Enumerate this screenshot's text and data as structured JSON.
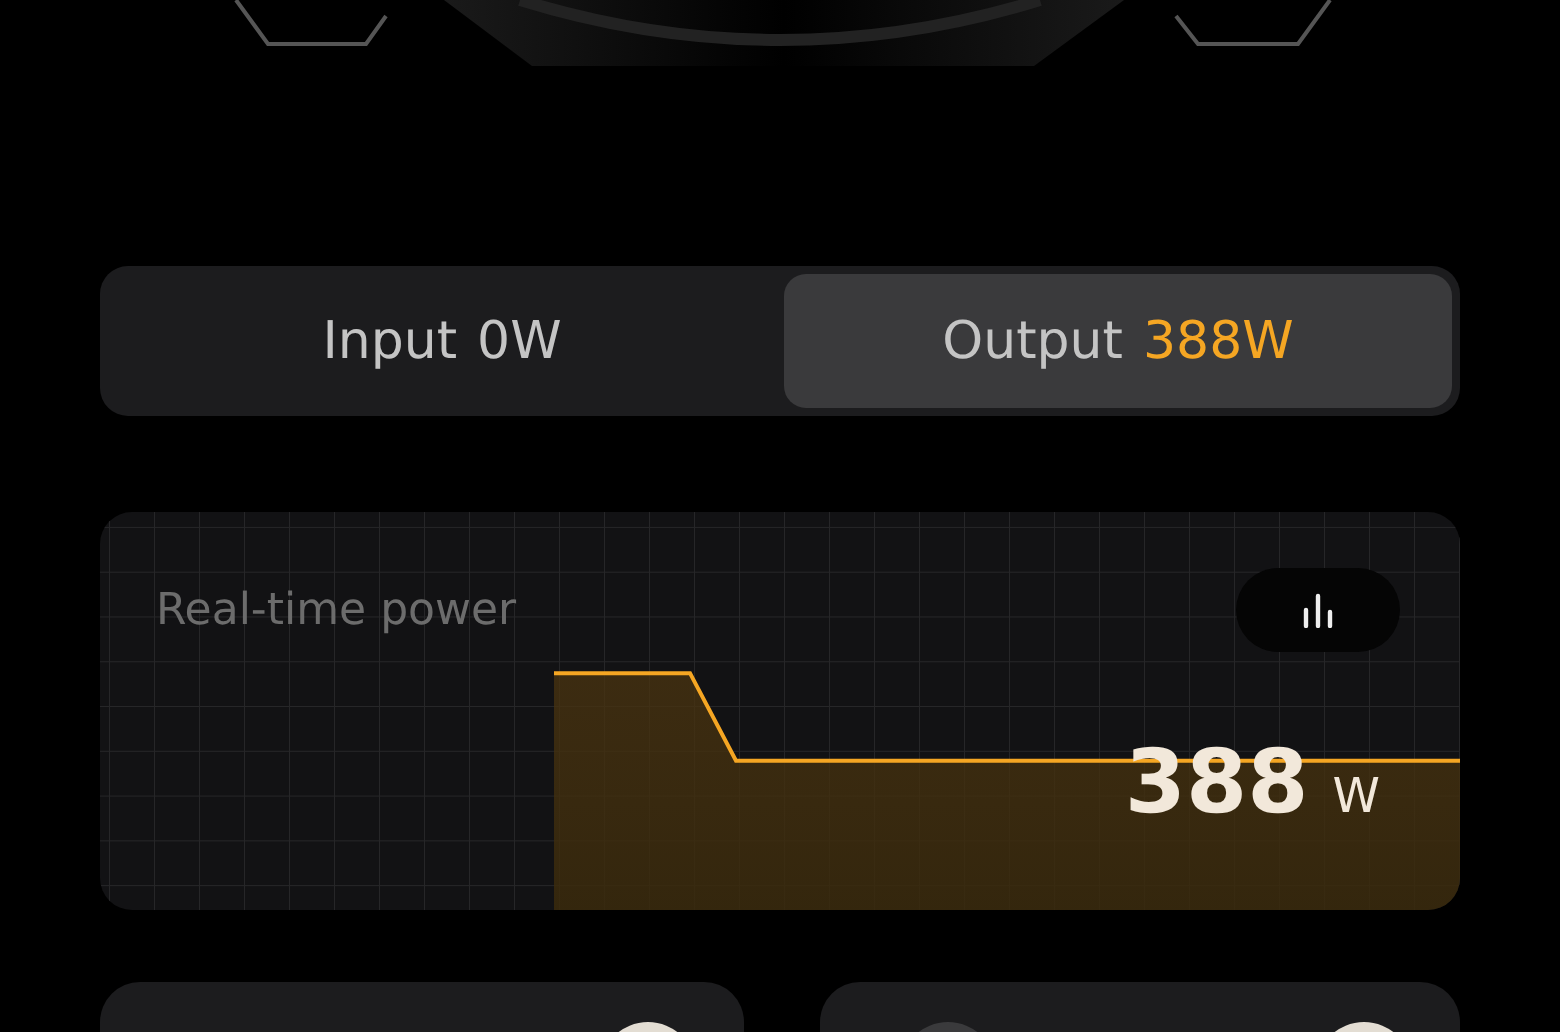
{
  "tabs": [
    {
      "label": "Input",
      "value": "0W",
      "selected": false
    },
    {
      "label": "Output",
      "value": "388W",
      "selected": true
    }
  ],
  "power_card": {
    "title": "Real-time power",
    "reading": "388",
    "unit": "W"
  }
}
